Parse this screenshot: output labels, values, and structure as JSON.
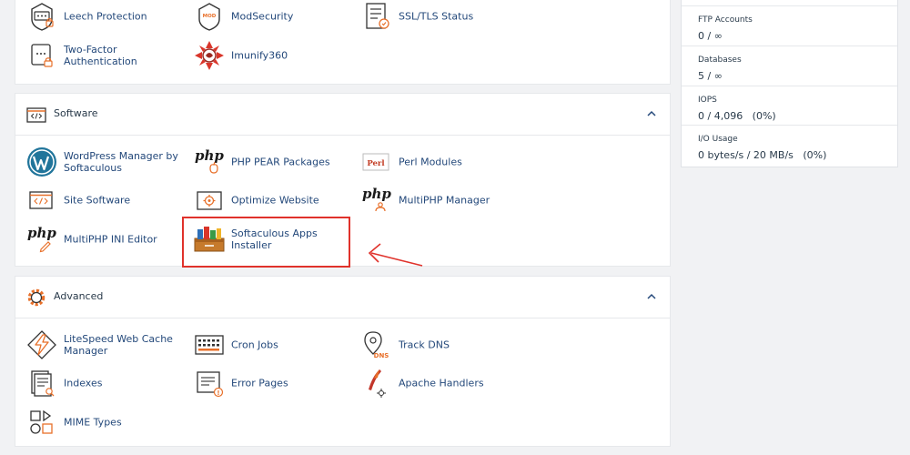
{
  "security": {
    "items": [
      {
        "label": "Leech Protection",
        "icon": "leech-protection-icon"
      },
      {
        "label": "ModSecurity",
        "icon": "modsecurity-icon",
        "badge": "MOD"
      },
      {
        "label": "SSL/TLS Status",
        "icon": "ssl-status-icon"
      },
      {
        "label": "Two-Factor Authentication",
        "icon": "two-factor-icon"
      },
      {
        "label": "Imunify360",
        "icon": "imunify360-icon"
      }
    ]
  },
  "software": {
    "title": "Software",
    "items": [
      {
        "label": "WordPress Manager by Softaculous",
        "icon": "wordpress-icon"
      },
      {
        "label": "PHP PEAR Packages",
        "icon": "php-pear-icon",
        "glyph": "php"
      },
      {
        "label": "Perl Modules",
        "icon": "perl-icon",
        "badge": "Perl"
      },
      {
        "label": "Site Software",
        "icon": "site-software-icon"
      },
      {
        "label": "Optimize Website",
        "icon": "optimize-website-icon"
      },
      {
        "label": "MultiPHP Manager",
        "icon": "multiphp-manager-icon",
        "glyph": "php"
      },
      {
        "label": "MultiPHP INI Editor",
        "icon": "multiphp-ini-icon",
        "glyph": "php"
      },
      {
        "label": "Softaculous Apps Installer",
        "icon": "softaculous-icon"
      }
    ]
  },
  "advanced": {
    "title": "Advanced",
    "items": [
      {
        "label": "LiteSpeed Web Cache Manager",
        "icon": "litespeed-icon"
      },
      {
        "label": "Cron Jobs",
        "icon": "cron-jobs-icon"
      },
      {
        "label": "Track DNS",
        "icon": "track-dns-icon",
        "badge": "DNS"
      },
      {
        "label": "Indexes",
        "icon": "indexes-icon"
      },
      {
        "label": "Error Pages",
        "icon": "error-pages-icon"
      },
      {
        "label": "Apache Handlers",
        "icon": "apache-handlers-icon"
      },
      {
        "label": "MIME Types",
        "icon": "mime-types-icon"
      }
    ]
  },
  "stats": [
    {
      "name": "FTP Accounts",
      "value": "0 / ∞"
    },
    {
      "name": "Databases",
      "value": "5 / ∞"
    },
    {
      "name": "IOPS",
      "value": "0 / 4,096   (0%)"
    },
    {
      "name": "I/O Usage",
      "value": "0 bytes/s / 20 MB/s   (0%)"
    }
  ],
  "colors": {
    "link": "#23487a",
    "accent": "#e8702a",
    "highlight": "#e0322b",
    "panel_border": "#e6e8eb",
    "background": "#f1f2f4"
  }
}
